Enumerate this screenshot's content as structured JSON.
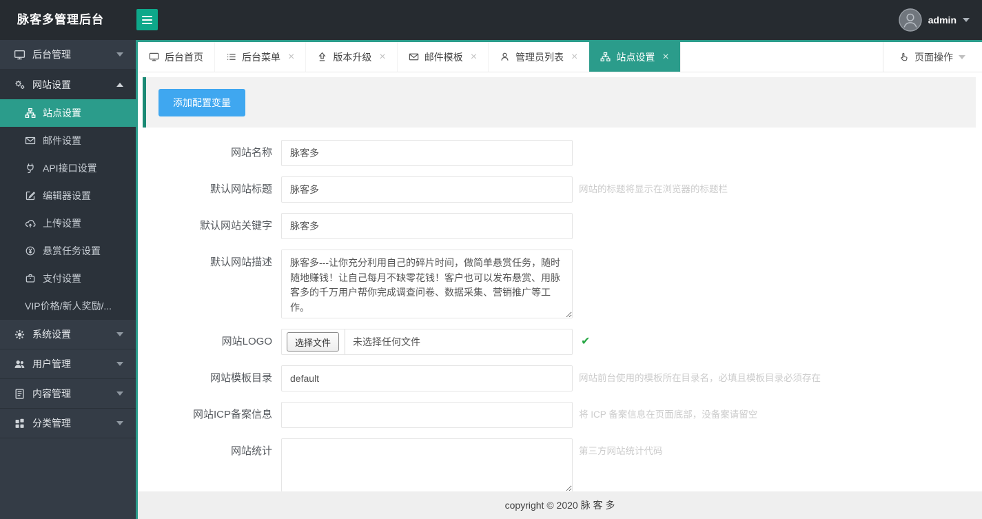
{
  "header": {
    "brand": "脉客多管理后台",
    "user": "admin"
  },
  "tabs": [
    {
      "label": "后台首页",
      "icon": "monitor-icon",
      "closable": false,
      "active": false
    },
    {
      "label": "后台菜单",
      "icon": "list-icon",
      "closable": true,
      "active": false
    },
    {
      "label": "版本升级",
      "icon": "upgrade-icon",
      "closable": true,
      "active": false
    },
    {
      "label": "邮件模板",
      "icon": "envelope-icon",
      "closable": true,
      "active": false
    },
    {
      "label": "管理员列表",
      "icon": "person-icon",
      "closable": true,
      "active": false
    },
    {
      "label": "站点设置",
      "icon": "sitemap-icon",
      "closable": true,
      "active": true
    }
  ],
  "page_actions_label": "页面操作",
  "sidebar": {
    "items_top": [
      {
        "label": "后台管理",
        "icon": "monitor-icon",
        "expanded": false
      },
      {
        "label": "网站设置",
        "icon": "gears-icon",
        "expanded": true
      }
    ],
    "sub": [
      {
        "label": "站点设置",
        "icon": "sitemap-icon",
        "active": true
      },
      {
        "label": "邮件设置",
        "icon": "envelope-icon",
        "active": false
      },
      {
        "label": "API接口设置",
        "icon": "plug-icon",
        "active": false
      },
      {
        "label": "编辑器设置",
        "icon": "edit-icon",
        "active": false
      },
      {
        "label": "上传设置",
        "icon": "cloud-upload-icon",
        "active": false
      },
      {
        "label": "悬赏任务设置",
        "icon": "yen-circle-icon",
        "active": false
      },
      {
        "label": "支付设置",
        "icon": "purse-icon",
        "active": false
      },
      {
        "label": "VIP价格/新人奖励/...",
        "icon": null,
        "active": false
      }
    ],
    "items_bottom": [
      {
        "label": "系统设置",
        "icon": "gear-icon"
      },
      {
        "label": "用户管理",
        "icon": "users-icon"
      },
      {
        "label": "内容管理",
        "icon": "document-icon"
      },
      {
        "label": "分类管理",
        "icon": "grid-icon"
      }
    ]
  },
  "toolbar": {
    "add_button": "添加配置变量"
  },
  "form": {
    "rows": [
      {
        "label": "网站名称",
        "value": "脉客多",
        "hint": ""
      },
      {
        "label": "默认网站标题",
        "value": "脉客多",
        "hint": "网站的标题将显示在浏览器的标题栏"
      },
      {
        "label": "默认网站关键字",
        "value": "脉客多",
        "hint": ""
      },
      {
        "label": "默认网站描述",
        "value": "脉客多---让你充分利用自己的碎片时间，做简单悬赏任务，随时随地赚钱！让自己每月不缺零花钱！客户也可以发布悬赏、用脉客多的千万用户帮你完成调查问卷、数据采集、营销推广等工作。",
        "hint": ""
      },
      {
        "label": "网站LOGO",
        "button": "选择文件",
        "filename": "未选择任何文件",
        "status": "valid",
        "hint": ""
      },
      {
        "label": "网站模板目录",
        "value": "default",
        "hint": "网站前台使用的模板所在目录名，必填且模板目录必须存在"
      },
      {
        "label": "网站ICP备案信息",
        "value": "",
        "hint": "将 ICP 备案信息在页面底部，没备案请留空"
      },
      {
        "label": "网站统计",
        "value": "",
        "hint": "第三方网站统计代码"
      }
    ]
  },
  "footer": {
    "copyright": "copyright © 2020 脉 客 多"
  },
  "glyphs": {
    "close": "×",
    "check": "✔"
  },
  "colors": {
    "accent": "#2b9c8b",
    "accent_dark": "#1c8a75",
    "button_blue": "#3fa7f0",
    "check_green": "#28a745",
    "header_bg": "#262b30",
    "sidebar_bg": "#343c46"
  }
}
